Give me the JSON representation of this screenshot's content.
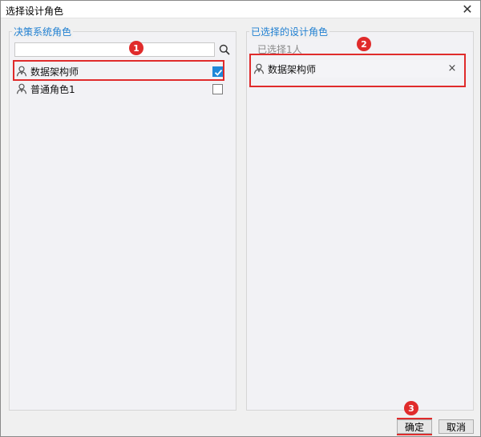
{
  "window": {
    "title": "选择设计角色",
    "close_glyph": "✕"
  },
  "left_panel": {
    "legend": "决策系统角色",
    "search": {
      "value": "",
      "placeholder": ""
    },
    "roles": [
      {
        "name": "数据架构师",
        "checked": true
      },
      {
        "name": "普通角色1",
        "checked": false
      }
    ]
  },
  "right_panel": {
    "legend": "已选择的设计角色",
    "selected_count_text": "已选择1人",
    "selected": [
      {
        "name": "数据架构师",
        "remove_glyph": "×"
      }
    ]
  },
  "buttons": {
    "ok": "确定",
    "cancel": "取消"
  },
  "annotations": {
    "marker1": "1",
    "marker2": "2",
    "marker3": "3"
  },
  "colors": {
    "accent": "#1f7fd1",
    "checkbox": "#1e88d8",
    "annotation": "#e02b2b"
  },
  "icons": {
    "role": "user-icon",
    "search": "search-icon",
    "close": "close-icon"
  }
}
